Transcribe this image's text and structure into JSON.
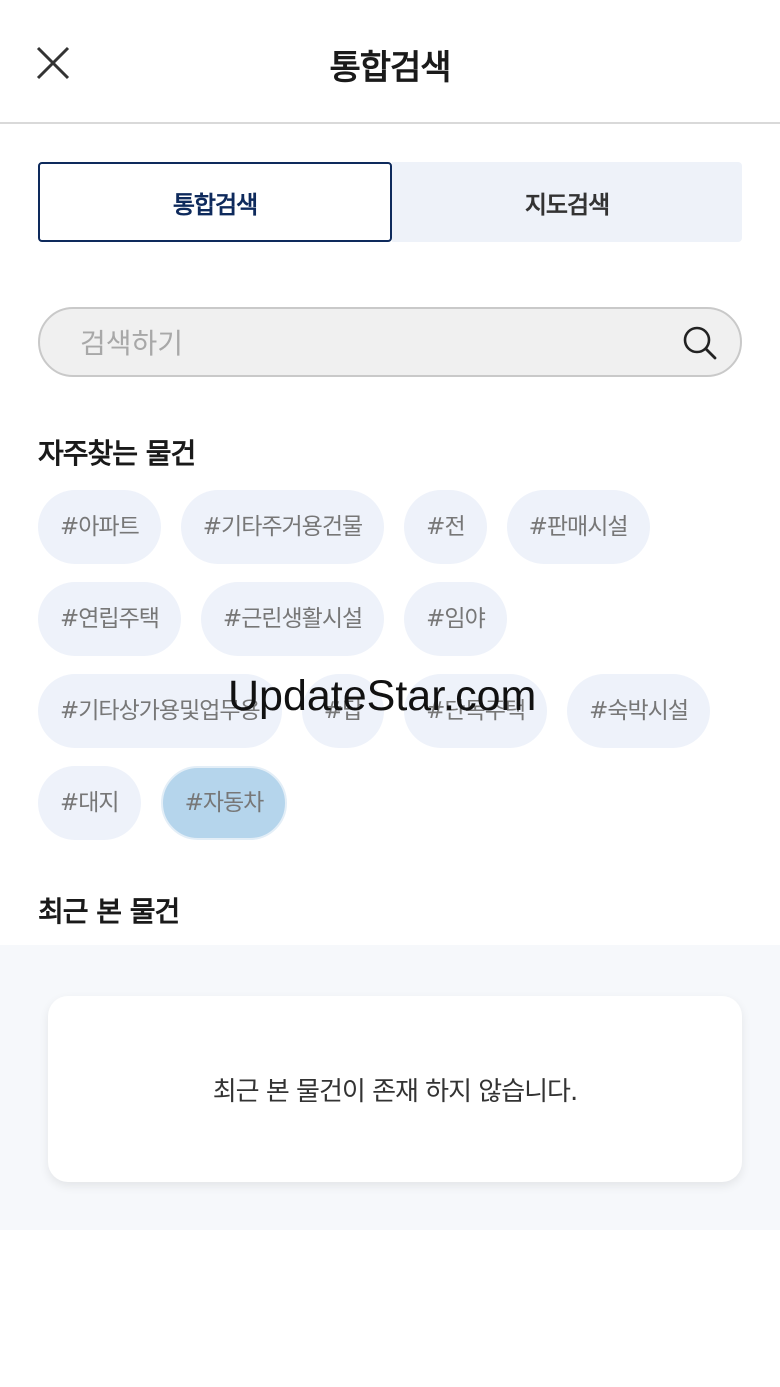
{
  "header": {
    "title": "통합검색",
    "close_icon": "close-icon"
  },
  "tabs": [
    {
      "label": "통합검색",
      "active": true
    },
    {
      "label": "지도검색",
      "active": false
    }
  ],
  "search": {
    "placeholder": "검색하기",
    "value": "",
    "icon": "search-icon"
  },
  "frequent": {
    "title": "자주찾는 물건",
    "rows": [
      [
        "#아파트",
        "#기타주거용건물",
        "#전",
        "#판매시설"
      ],
      [
        "#연립주택",
        "#근린생활시설",
        "#임야"
      ],
      [
        "#기타상가용및업무용",
        "#답",
        "#단독주택",
        "#숙박시설"
      ],
      [
        "#대지",
        "#자동차"
      ]
    ],
    "selected": "#자동차"
  },
  "recent": {
    "title": "최근 본 물건",
    "empty_message": "최근 본 물건이 존재 하지 않습니다."
  },
  "watermark": "UpdateStar.com",
  "colors": {
    "accent": "#0e2a5c",
    "chip_bg": "#eef2fa",
    "chip_selected": "#b5d5ec"
  }
}
